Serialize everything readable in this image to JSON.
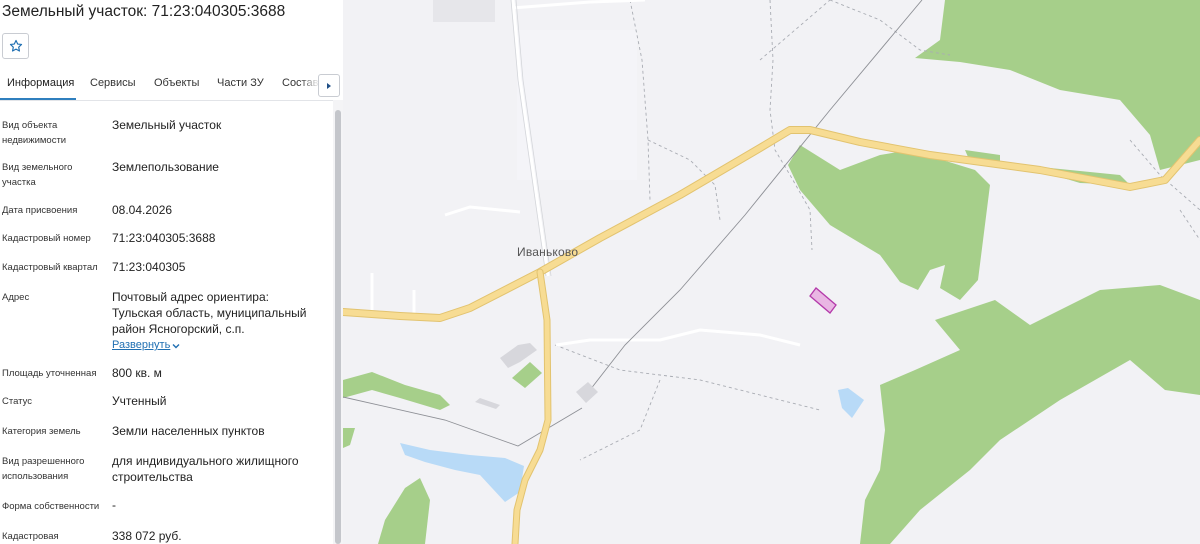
{
  "header": {
    "title": "Земельный участок: 71:23:040305:3688"
  },
  "tabs": [
    {
      "label": "Информация"
    },
    {
      "label": "Сервисы"
    },
    {
      "label": "Объекты"
    },
    {
      "label": "Части ЗУ"
    },
    {
      "label": "Состав"
    }
  ],
  "fields": [
    {
      "label": "Вид объекта недвижимости",
      "value": "Земельный участок"
    },
    {
      "label": "Вид земельного участка",
      "value": "Землепользование"
    },
    {
      "label": "Дата присвоения",
      "value": "08.04.2026"
    },
    {
      "label": "Кадастровый номер",
      "value": "71:23:040305:3688"
    },
    {
      "label": "Кадастровый квартал",
      "value": "71:23:040305"
    },
    {
      "label": "Адрес",
      "value": "Почтовый адрес ориентира: Тульская область, муниципальный район Ясногорский, с.п."
    },
    {
      "label": "Площадь уточненная",
      "value": "800 кв. м"
    },
    {
      "label": "Статус",
      "value": "Учтенный"
    },
    {
      "label": "Категория земель",
      "value": "Земли населенных пунктов"
    },
    {
      "label": "Вид разрешенного использования",
      "value": "для индивидуального жилищного строительства"
    },
    {
      "label": "Форма собственности",
      "value": "-"
    },
    {
      "label": "Кадастровая",
      "value": "338 072 руб."
    }
  ],
  "expand_link": "Развернуть",
  "map": {
    "place_label": "Иваньково"
  },
  "icons": {
    "favorite": "star-icon",
    "tabs_next": "chevron-right-icon",
    "expand": "chevron-down-icon"
  },
  "colors": {
    "accent": "#2f7fbe",
    "forest": "#a6cf8a",
    "road": "#f7dc93",
    "water": "#b8daf7",
    "parcel": "#b43aaa"
  }
}
